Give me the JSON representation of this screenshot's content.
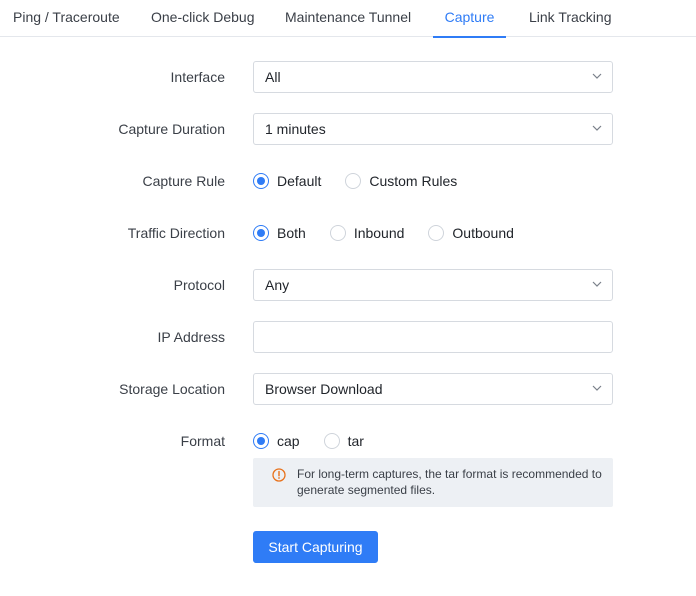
{
  "tabs": [
    {
      "label": "Ping / Traceroute"
    },
    {
      "label": "One-click Debug"
    },
    {
      "label": "Maintenance Tunnel"
    },
    {
      "label": "Capture",
      "active": true
    },
    {
      "label": "Link Tracking"
    }
  ],
  "form": {
    "interface": {
      "label": "Interface",
      "value": "All"
    },
    "capture_duration": {
      "label": "Capture Duration",
      "value": "1 minutes"
    },
    "capture_rule": {
      "label": "Capture Rule",
      "options": [
        "Default",
        "Custom Rules"
      ],
      "selected": "Default"
    },
    "traffic_direction": {
      "label": "Traffic Direction",
      "options": [
        "Both",
        "Inbound",
        "Outbound"
      ],
      "selected": "Both"
    },
    "protocol": {
      "label": "Protocol",
      "value": "Any"
    },
    "ip_address": {
      "label": "IP Address",
      "value": ""
    },
    "storage_location": {
      "label": "Storage Location",
      "value": "Browser Download"
    },
    "format": {
      "label": "Format",
      "options": [
        "cap",
        "tar"
      ],
      "selected": "cap",
      "notice": "For long-term captures, the tar format is recommended to generate segmented files."
    }
  },
  "actions": {
    "start_label": "Start Capturing"
  },
  "colors": {
    "accent": "#2f7cf6",
    "warning": "#e8711a"
  },
  "icons": {
    "select_arrow": "chevron-down-icon",
    "notice": "warning-circle-icon"
  }
}
